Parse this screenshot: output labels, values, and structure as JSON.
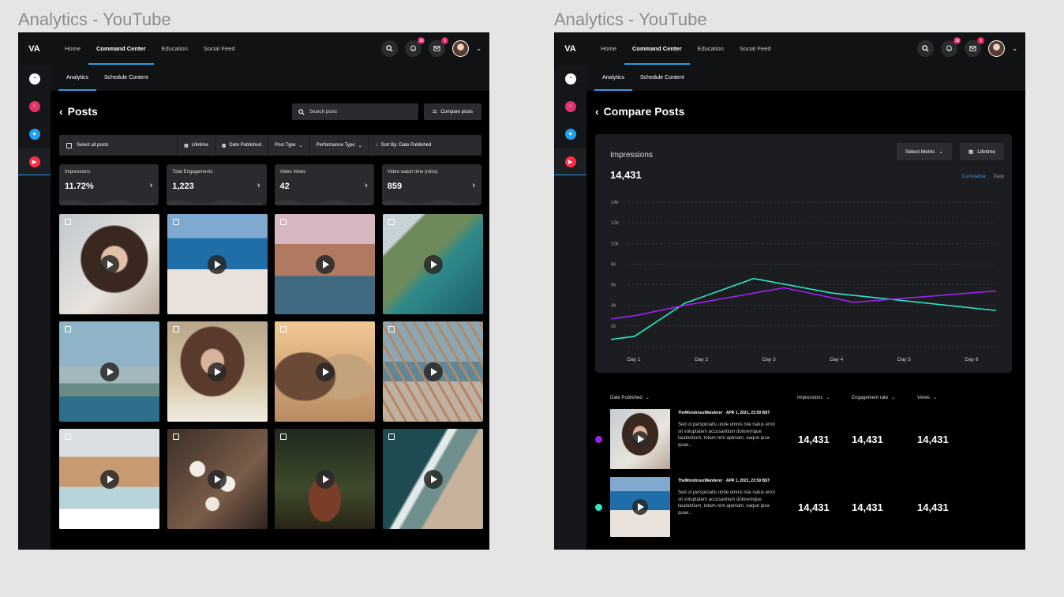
{
  "frames": [
    {
      "title": "Analytics - YouTube",
      "logo": "VA",
      "nav": [
        "Home",
        "Command Center",
        "Education",
        "Social Feed"
      ],
      "badges": {
        "notifications": "10",
        "messages": "1"
      },
      "subnav": [
        "Analytics",
        "Schedule Content"
      ],
      "page_title": "Posts",
      "search_placeholder": "Search posts",
      "compare_label": "Compare posts",
      "filters": {
        "select_all": "Select all posts",
        "lifetime": "Lifetime",
        "date_published": "Date Published",
        "post_type": "Post Type",
        "performance_type": "Performance Type",
        "sort_by": "Sort By: Date Published"
      },
      "stats": [
        {
          "label": "Impressions",
          "value": "11.72%"
        },
        {
          "label": "Total Engagements",
          "value": "1,223"
        },
        {
          "label": "Video Views",
          "value": "42"
        },
        {
          "label": "Video watch time (mins)",
          "value": "859"
        }
      ]
    },
    {
      "title": "Analytics - YouTube",
      "logo": "VA",
      "nav": [
        "Home",
        "Command Center",
        "Education",
        "Social Feed"
      ],
      "badges": {
        "notifications": "10",
        "messages": "1"
      },
      "subnav": [
        "Analytics",
        "Schedule Content"
      ],
      "page_title": "Compare Posts",
      "chart_card": {
        "title": "Impressions",
        "value": "14,431",
        "select_metric": "Select Metric",
        "lifetime": "Lifetime",
        "cumulative": "Cumulative",
        "daily": "Daily"
      },
      "table": {
        "headers": [
          "Date Published",
          "Impressions",
          "Engagement rate",
          "Views"
        ],
        "rows": [
          {
            "author": "TheWondrousWanderer",
            "date": "APR 1, 2021, 23:59 BST",
            "text": "Sed ut perspiciatis unde omnis iste natus error sit voluptatem accusantium doloremque laudantium, totam rem aperiam, eaque ipsa quae...",
            "impressions": "14,431",
            "engagement": "14,431",
            "views": "14,431",
            "color": "#a020f0"
          },
          {
            "author": "TheWondrousWanderer",
            "date": "APR 1, 2021, 23:59 BST",
            "text": "Sed ut perspiciatis unde omnis iste natus error sit voluptatem accusantium doloremque laudantium, totam rem aperiam, eaque ipsa quae...",
            "impressions": "14,431",
            "engagement": "14,431",
            "views": "14,431",
            "color": "#2ee6c8"
          }
        ]
      }
    }
  ],
  "chart_data": {
    "type": "line",
    "categories": [
      "Day 1",
      "Day 2",
      "Day 3",
      "Day 4",
      "Day 5",
      "Day 6"
    ],
    "yticks": [
      "14k",
      "12k",
      "10k",
      "8k",
      "6k",
      "4k",
      "2k"
    ],
    "ylim": [
      0,
      14000
    ],
    "grid": true,
    "series": [
      {
        "color": "#2ee6c8",
        "values": [
          700,
          1000,
          4200,
          6600,
          5200,
          3500
        ],
        "x": [
          0,
          0.32,
          1,
          1.94,
          3,
          4.9
        ]
      },
      {
        "color": "#a020f0",
        "values": [
          2700,
          3000,
          4000,
          5700,
          4300,
          5400
        ],
        "x": [
          0,
          0.32,
          1,
          2.35,
          3.3,
          4.9
        ]
      }
    ]
  }
}
